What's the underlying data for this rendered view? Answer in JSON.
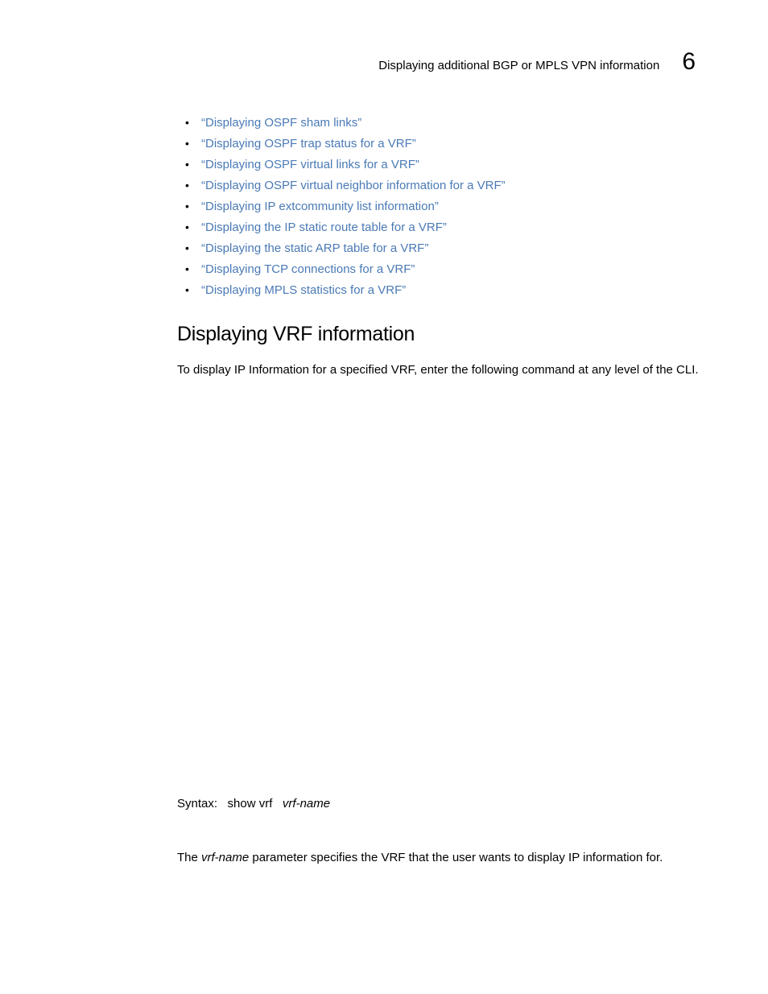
{
  "header": {
    "title": "Displaying additional BGP or MPLS VPN information",
    "chapter": "6"
  },
  "bullets": {
    "items": [
      "“Displaying OSPF sham links”",
      "“Displaying OSPF trap status for a VRF”",
      "“Displaying OSPF virtual links for a VRF”",
      "“Displaying OSPF virtual neighbor information for a VRF”",
      "“Displaying IP extcommunity list information”",
      "“Displaying the IP static route table for a VRF”",
      "“Displaying the static ARP table for a VRF”",
      "“Displaying TCP connections for a VRF”",
      "“Displaying MPLS statistics for a VRF”"
    ]
  },
  "section": {
    "heading": "Displaying VRF information",
    "intro": "To display IP Information for a specified VRF, enter the following command at any level of the CLI."
  },
  "syntax": {
    "label": "Syntax:",
    "command": "show vrf",
    "arg": "vrf-name"
  },
  "param": {
    "pre": "The ",
    "name": "vrf-name",
    "post": " parameter specifies the VRF that the user wants to display IP information for."
  }
}
